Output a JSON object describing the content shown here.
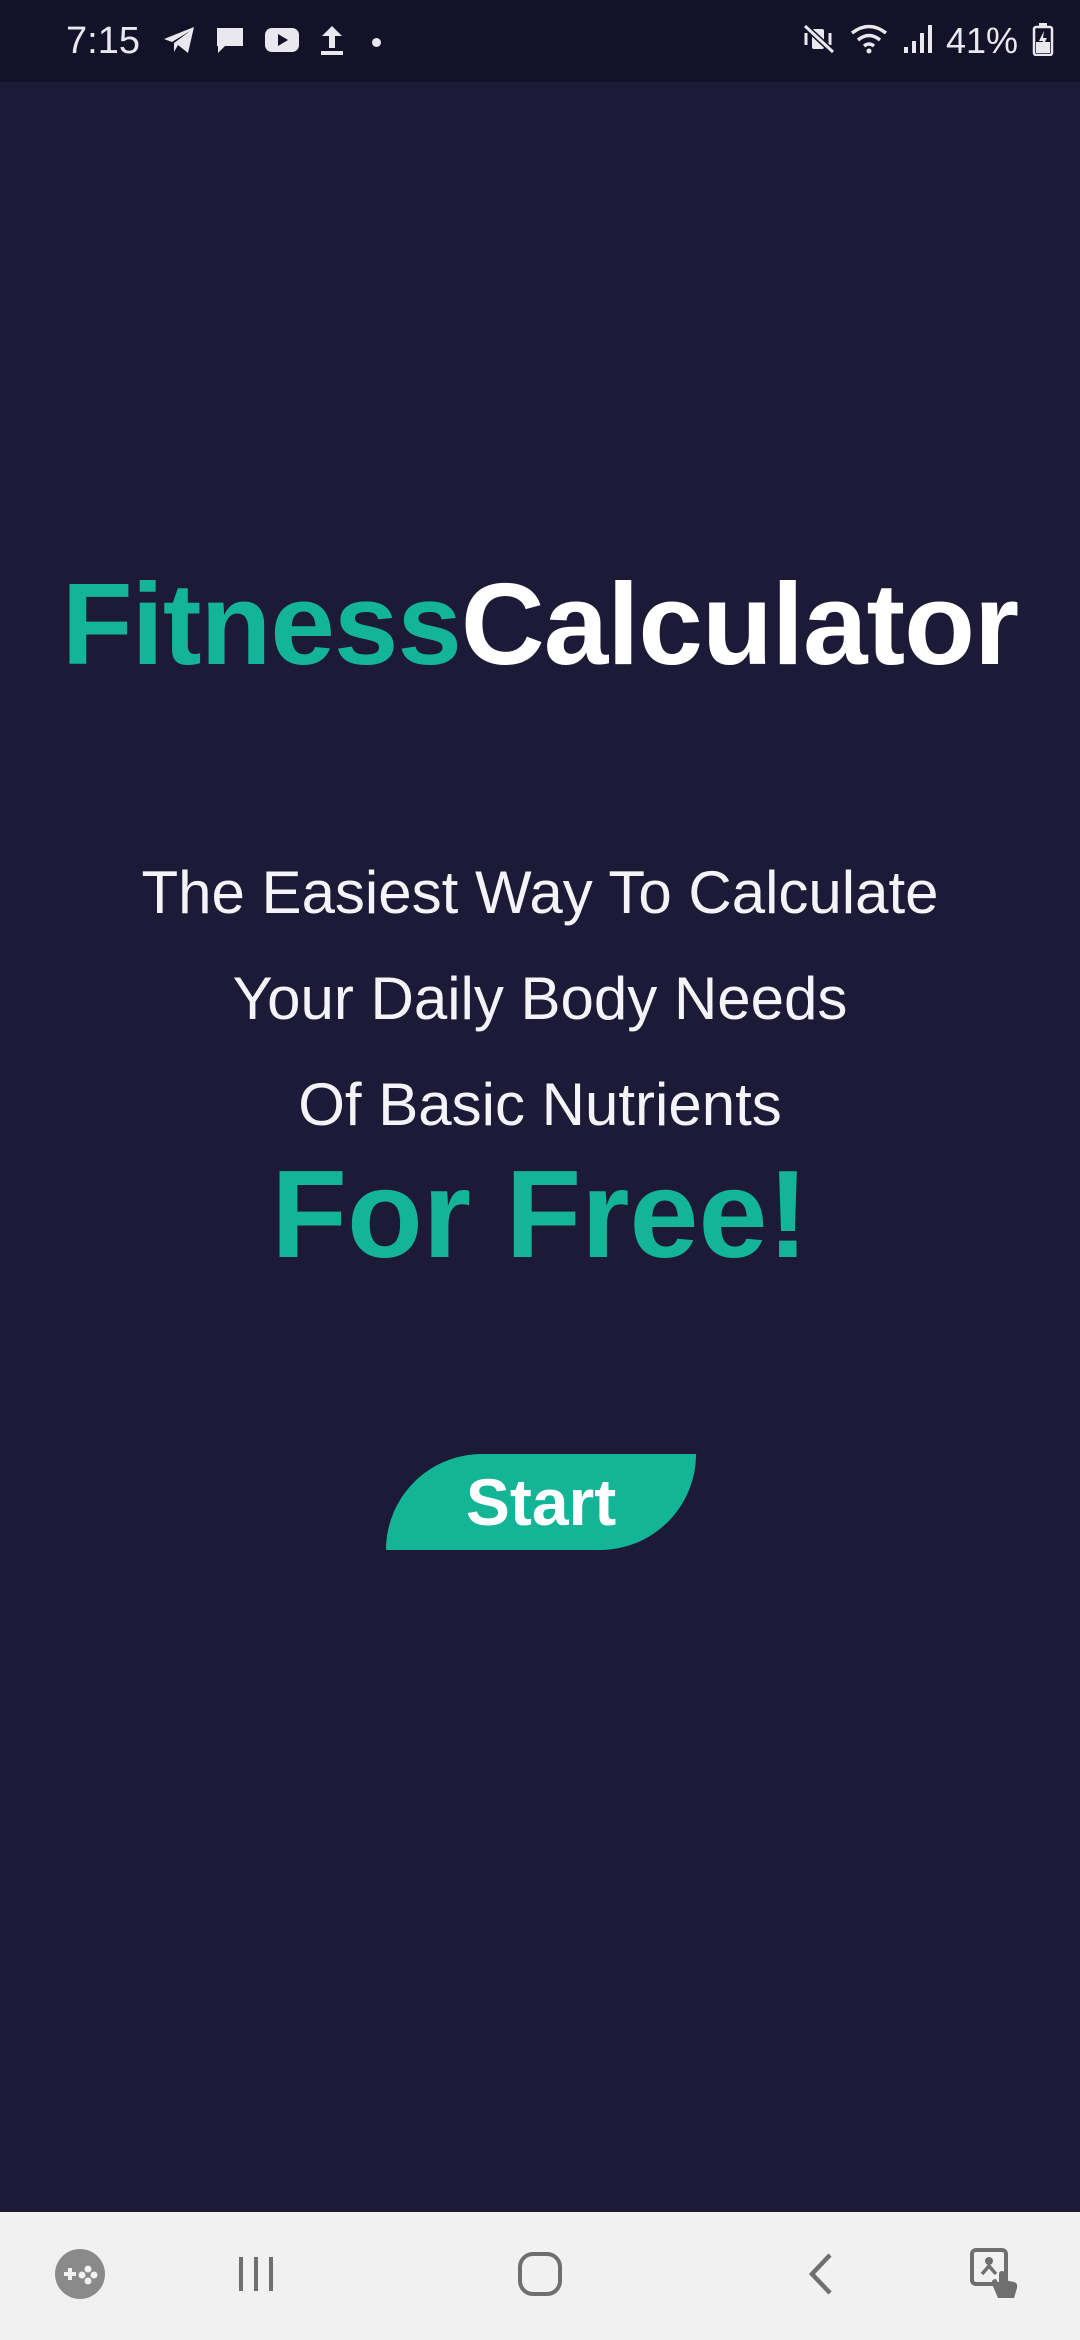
{
  "status_bar": {
    "time": "7:15",
    "battery": "41%",
    "left_icons": [
      "telegram-icon",
      "chat-icon",
      "youtube-icon",
      "upload-icon",
      "dot"
    ],
    "right_icons": [
      "mute-vibrate-icon",
      "wifi-icon",
      "signal-icon",
      "battery-icon"
    ]
  },
  "app": {
    "title_part1": "Fitness",
    "title_part2": "Calculator",
    "tagline": [
      "The Easiest Way To Calculate",
      "Your Daily Body Needs",
      "Of Basic Nutrients"
    ],
    "highlight": "For Free!",
    "start_label": "Start"
  },
  "colors": {
    "background": "#1c1a37",
    "accent": "#13b497",
    "text": "#ffffff",
    "nav_bar": "#f1f1f1"
  },
  "nav_bar": {
    "items": [
      "game-launcher-icon",
      "recent-apps-icon",
      "home-icon",
      "back-icon",
      "accessibility-icon"
    ]
  }
}
